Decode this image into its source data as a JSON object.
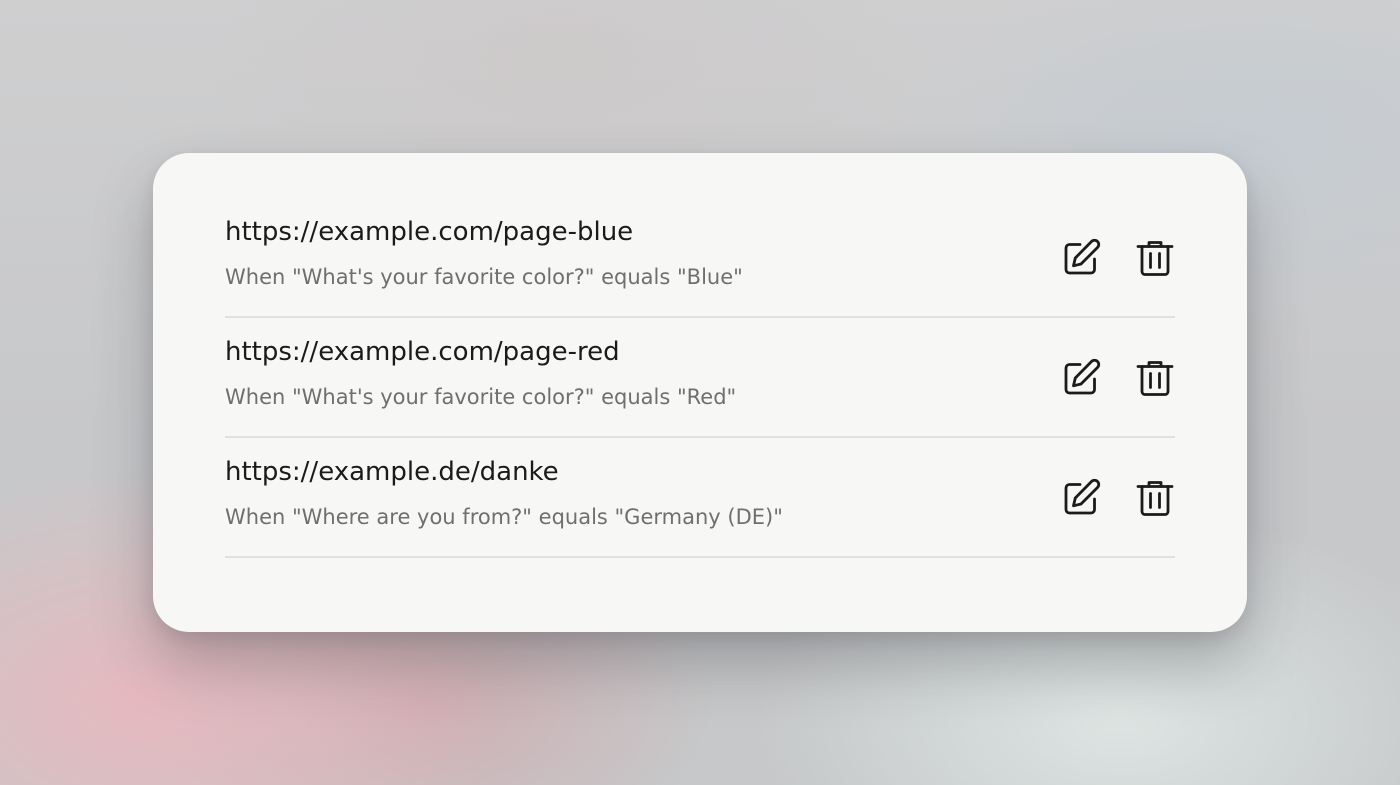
{
  "redirects": [
    {
      "url": "https://example.com/page-blue",
      "condition": "When \"What's your favorite color?\" equals \"Blue\"",
      "edit_icon": "edit-icon",
      "delete_icon": "trash-icon"
    },
    {
      "url": "https://example.com/page-red",
      "condition": "When \"What's your favorite color?\" equals \"Red\"",
      "edit_icon": "edit-icon",
      "delete_icon": "trash-icon"
    },
    {
      "url": "https://example.de/danke",
      "condition": "When \"Where are you from?\" equals \"Germany (DE)\"",
      "edit_icon": "edit-icon",
      "delete_icon": "trash-icon"
    }
  ],
  "colors": {
    "card_background": "#f7f7f5",
    "url_text": "#1b1b1b",
    "condition_text": "#6f6f6d",
    "divider": "#e1e1df",
    "icon_stroke": "#1b1b1b"
  }
}
